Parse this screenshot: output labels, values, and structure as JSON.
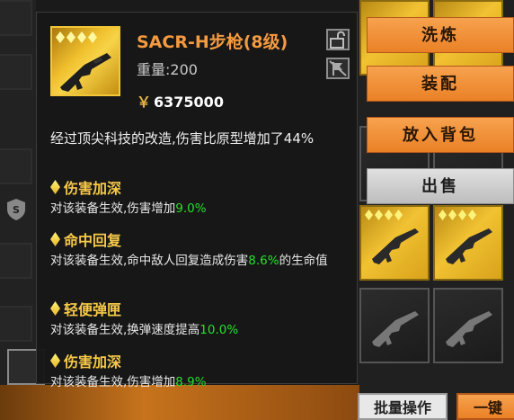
{
  "item": {
    "name": "SACR-H步枪(8级)",
    "weight_label": "重量:",
    "weight_value": "200",
    "price_symbol": "￥",
    "price": "6375000",
    "description": "经过顶尖科技的改造,伤害比原型增加了44%",
    "quality_stars": 4
  },
  "traits": [
    {
      "title": "伤害加深",
      "pre": "对该装备生效,伤害增加",
      "value": "9.0%",
      "post": ""
    },
    {
      "title": "命中回复",
      "pre": "对该装备生效,命中敌人回复造成伤害",
      "value": "8.6%",
      "post": "的生命值"
    },
    {
      "title": "轻便弹匣",
      "pre": "对该装备生效,换弹速度提高",
      "value": "10.0%",
      "post": ""
    },
    {
      "title": "伤害加深",
      "pre": "对该装备生效,伤害增加",
      "value": "8.9%",
      "post": ""
    }
  ],
  "actions": {
    "refine": "洗炼",
    "equip": "装配",
    "to_backpack": "放入背包",
    "sell": "出售"
  },
  "bottom": {
    "batch": "批量操作",
    "one_key": "一键"
  },
  "colors": {
    "name": "#f59a3f",
    "trait_title": "#f6c948",
    "value_green": "#25e02c",
    "button_orange": "#ea8126"
  },
  "icons": [
    "lock-icon",
    "no-flag-icon",
    "shield-icon",
    "rifle-icon",
    "diamond-icon"
  ]
}
